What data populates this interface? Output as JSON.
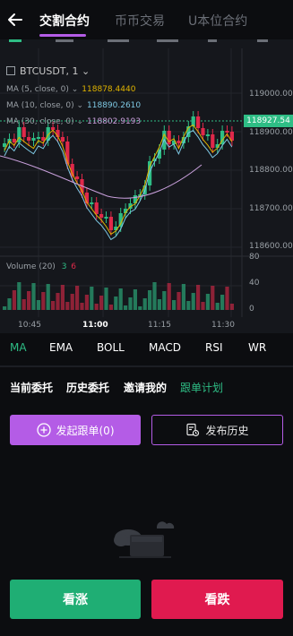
{
  "header": {
    "tabs": [
      {
        "label": "交割合约",
        "active": true
      },
      {
        "label": "币币交易",
        "active": false
      },
      {
        "label": "U本位合约",
        "active": false
      }
    ]
  },
  "chart": {
    "symbol": "BTCUSDT, 1",
    "ma": [
      {
        "label": "MA (5, close, 0)",
        "value": "118878.4440",
        "color": "#e0b400"
      },
      {
        "label": "MA (10, close, 0)",
        "value": "118890.2610",
        "color": "#7ec8e3"
      },
      {
        "label": "MA (30, close, 0)",
        "value": "118802.9193",
        "color": "#c9a0dc"
      }
    ],
    "price_axis": [
      "119000.00",
      "118900.00",
      "118800.00",
      "118700.00",
      "118600.00"
    ],
    "last_price": "118927.54",
    "volume": {
      "label": "Volume (20)",
      "up": "3",
      "down": "6",
      "axis": [
        "80",
        "40",
        "0"
      ]
    },
    "time_axis": [
      "10:45",
      "11:00",
      "11:15",
      "11:30"
    ],
    "up_color": "#2ebd85",
    "down_color": "#e0294a"
  },
  "indicators": [
    "MA",
    "EMA",
    "BOLL",
    "MACD",
    "RSI",
    "WR"
  ],
  "order_tabs": [
    {
      "label": "当前委托",
      "active": false
    },
    {
      "label": "历史委托",
      "active": false
    },
    {
      "label": "邀请我的",
      "active": false
    },
    {
      "label": "跟单计划",
      "active": true
    }
  ],
  "actions": {
    "start_follow": "发起跟单(0)",
    "publish_history": "发布历史"
  },
  "trade": {
    "long": "看涨",
    "short": "看跌"
  }
}
